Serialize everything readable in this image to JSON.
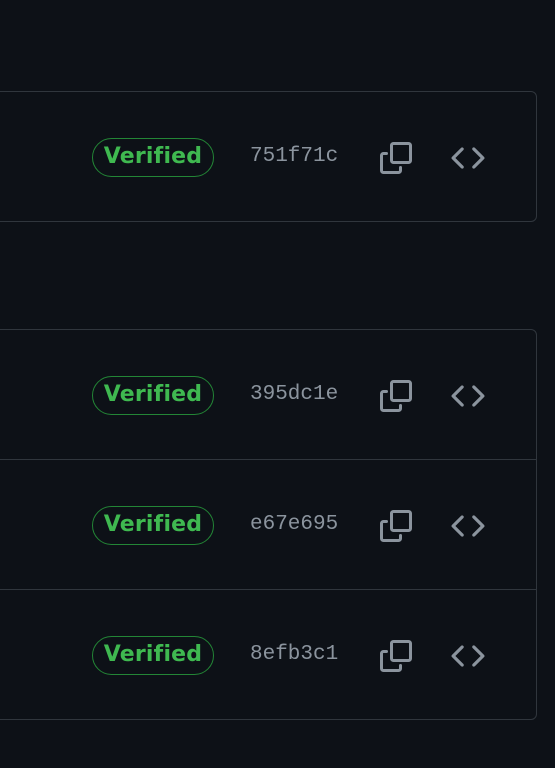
{
  "colors": {
    "background": "#0d1117",
    "border": "#30363d",
    "verified_text": "#3fb950",
    "verified_border": "#238636",
    "sha_text": "#8b949e",
    "icon": "#8b949e"
  },
  "commits": [
    {
      "badge": "Verified",
      "sha": "751f71c",
      "copy_icon": "copy-icon",
      "browse_icon": "code-icon"
    },
    {
      "badge": "Verified",
      "sha": "395dc1e",
      "copy_icon": "copy-icon",
      "browse_icon": "code-icon"
    },
    {
      "badge": "Verified",
      "sha": "e67e695",
      "copy_icon": "copy-icon",
      "browse_icon": "code-icon"
    },
    {
      "badge": "Verified",
      "sha": "8efb3c1",
      "copy_icon": "copy-icon",
      "browse_icon": "code-icon"
    }
  ]
}
